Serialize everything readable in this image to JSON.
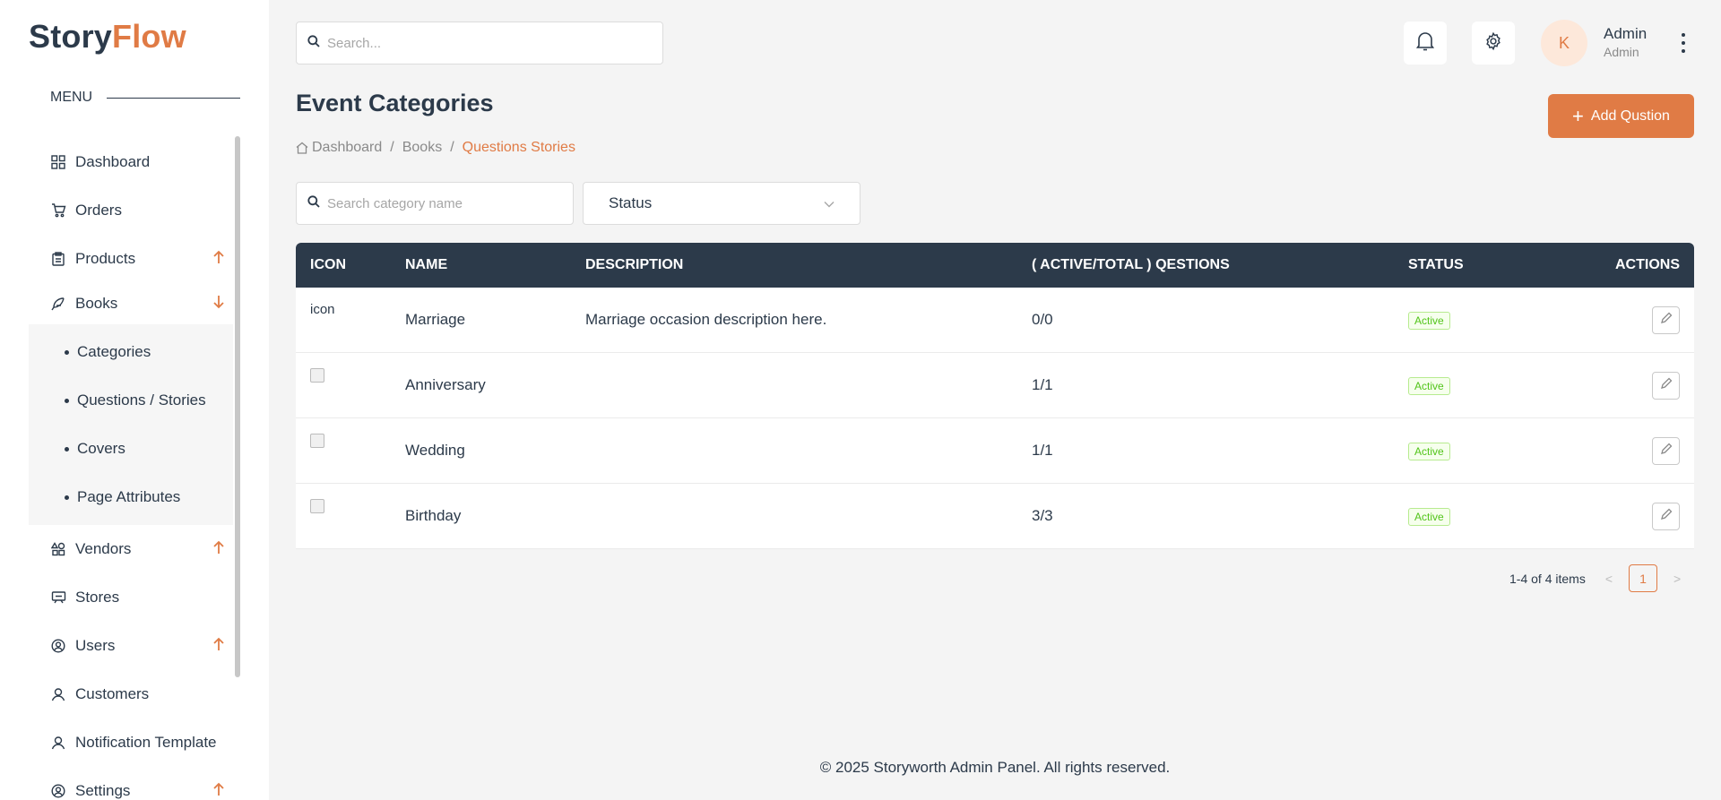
{
  "brand": {
    "part1": "Story",
    "part2": "Flow"
  },
  "menu_label": "MENU",
  "sidebar": {
    "items": [
      {
        "label": "Dashboard"
      },
      {
        "label": "Orders"
      },
      {
        "label": "Products"
      },
      {
        "label": "Books"
      },
      {
        "label": "Vendors"
      },
      {
        "label": "Stores"
      },
      {
        "label": "Users"
      },
      {
        "label": "Customers"
      },
      {
        "label": "Notification Template"
      },
      {
        "label": "Settings"
      }
    ],
    "books_sub": [
      {
        "label": "Categories"
      },
      {
        "label": "Questions / Stories"
      },
      {
        "label": "Covers"
      },
      {
        "label": "Page Attributes"
      }
    ]
  },
  "topbar": {
    "search_placeholder": "Search...",
    "avatar_initial": "K",
    "user_name": "Admin",
    "user_role": "Admin"
  },
  "page": {
    "title": "Event Categories",
    "add_button": "Add Qustion",
    "breadcrumb": [
      "Dashboard",
      "Books",
      "Questions Stories"
    ]
  },
  "filters": {
    "search_placeholder": "Search category name",
    "status_label": "Status"
  },
  "table": {
    "headers": [
      "ICON",
      "NAME",
      "DESCRIPTION",
      "( ACTIVE/TOTAL ) QESTIONS",
      "STATUS",
      "ACTIONS"
    ],
    "rows": [
      {
        "icon_alt": "icon",
        "name": "Marriage",
        "description": "Marriage occasion description here.",
        "questions": "0/0",
        "status": "Active"
      },
      {
        "icon_alt": "",
        "name": "Anniversary",
        "description": "",
        "questions": "1/1",
        "status": "Active"
      },
      {
        "icon_alt": "",
        "name": "Wedding",
        "description": "",
        "questions": "1/1",
        "status": "Active"
      },
      {
        "icon_alt": "",
        "name": "Birthday",
        "description": "",
        "questions": "3/3",
        "status": "Active"
      }
    ]
  },
  "pagination": {
    "summary": "1-4 of 4 items",
    "current_page": "1"
  },
  "footer": "© 2025 Storyworth Admin Panel. All rights reserved.",
  "colors": {
    "accent": "#e07b45",
    "header_dark": "#2c3a4a",
    "active_green": "#52c41a"
  }
}
